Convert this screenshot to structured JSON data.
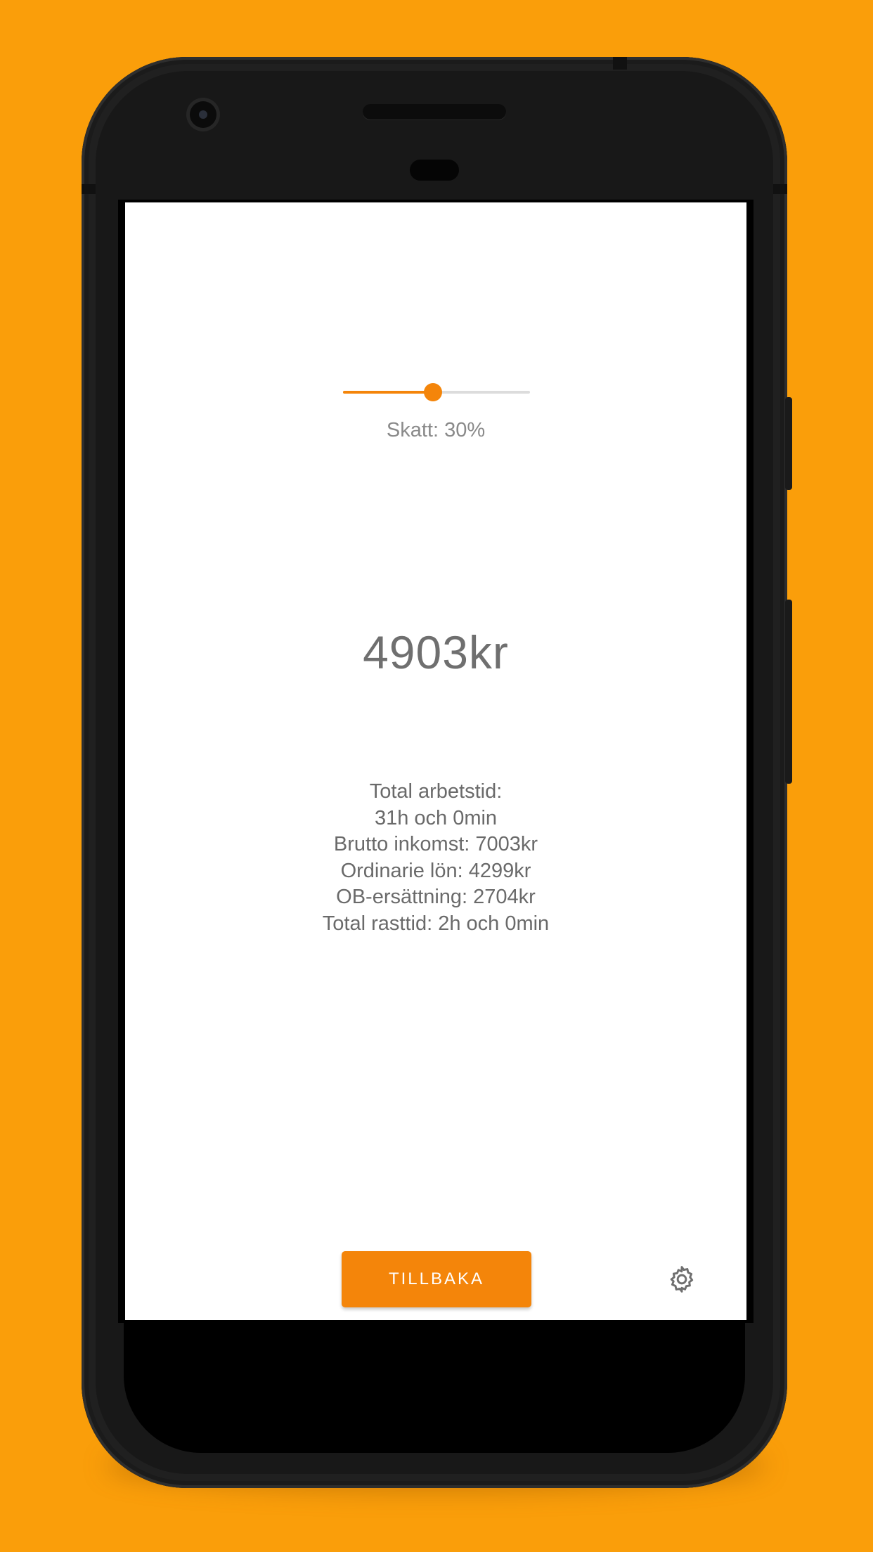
{
  "tax_slider": {
    "value_percent": 30,
    "label": "Skatt: 30%",
    "accent_color": "#F4850A"
  },
  "net_income": "4903kr",
  "summary": {
    "work_time_label": "Total arbetstid:",
    "work_time_value": "31h och 0min",
    "gross_income": "Brutto inkomst: 7003kr",
    "ordinary_salary": "Ordinarie lön: 4299kr",
    "ob_compensation": "OB-ersättning: 2704kr",
    "break_time": "Total rasttid: 2h och 0min"
  },
  "back_button_label": "TILLBAKA",
  "icons": {
    "settings": "gear-icon"
  },
  "colors": {
    "background": "#FA9E0A",
    "accent": "#F4850A"
  }
}
